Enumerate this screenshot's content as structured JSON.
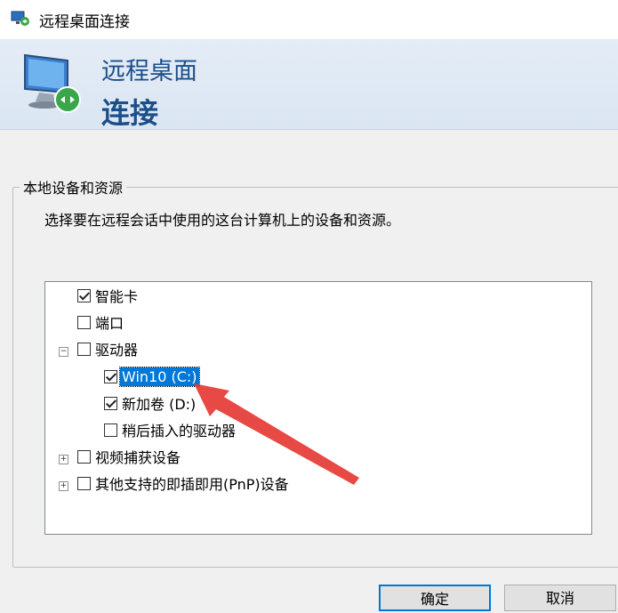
{
  "window": {
    "title": "远程桌面连接"
  },
  "banner": {
    "line1": "远程桌面",
    "line2": "连接"
  },
  "group": {
    "legend": "本地设备和资源",
    "description": "选择要在远程会话中使用的这台计算机上的设备和资源。"
  },
  "tree": {
    "items": [
      {
        "label": "智能卡",
        "checked": true,
        "expander": "",
        "level": 0
      },
      {
        "label": "端口",
        "checked": false,
        "expander": "",
        "level": 0
      },
      {
        "label": "驱动器",
        "checked": false,
        "expander": "−",
        "level": 0
      },
      {
        "label": "Win10 (C:)",
        "checked": true,
        "expander": "",
        "level": 1,
        "selected": true
      },
      {
        "label": "新加卷 (D:)",
        "checked": true,
        "expander": "",
        "level": 1
      },
      {
        "label": "稍后插入的驱动器",
        "checked": false,
        "expander": "",
        "level": 1
      },
      {
        "label": "视频捕获设备",
        "checked": false,
        "expander": "+",
        "level": 0
      },
      {
        "label": "其他支持的即插即用(PnP)设备",
        "checked": false,
        "expander": "+",
        "level": 0
      }
    ]
  },
  "buttons": {
    "ok": "确定",
    "cancel": "取消"
  },
  "colors": {
    "accent": "#0078d7",
    "banner_text": "#1b4f8a",
    "annotation_arrow": "#e53935"
  }
}
